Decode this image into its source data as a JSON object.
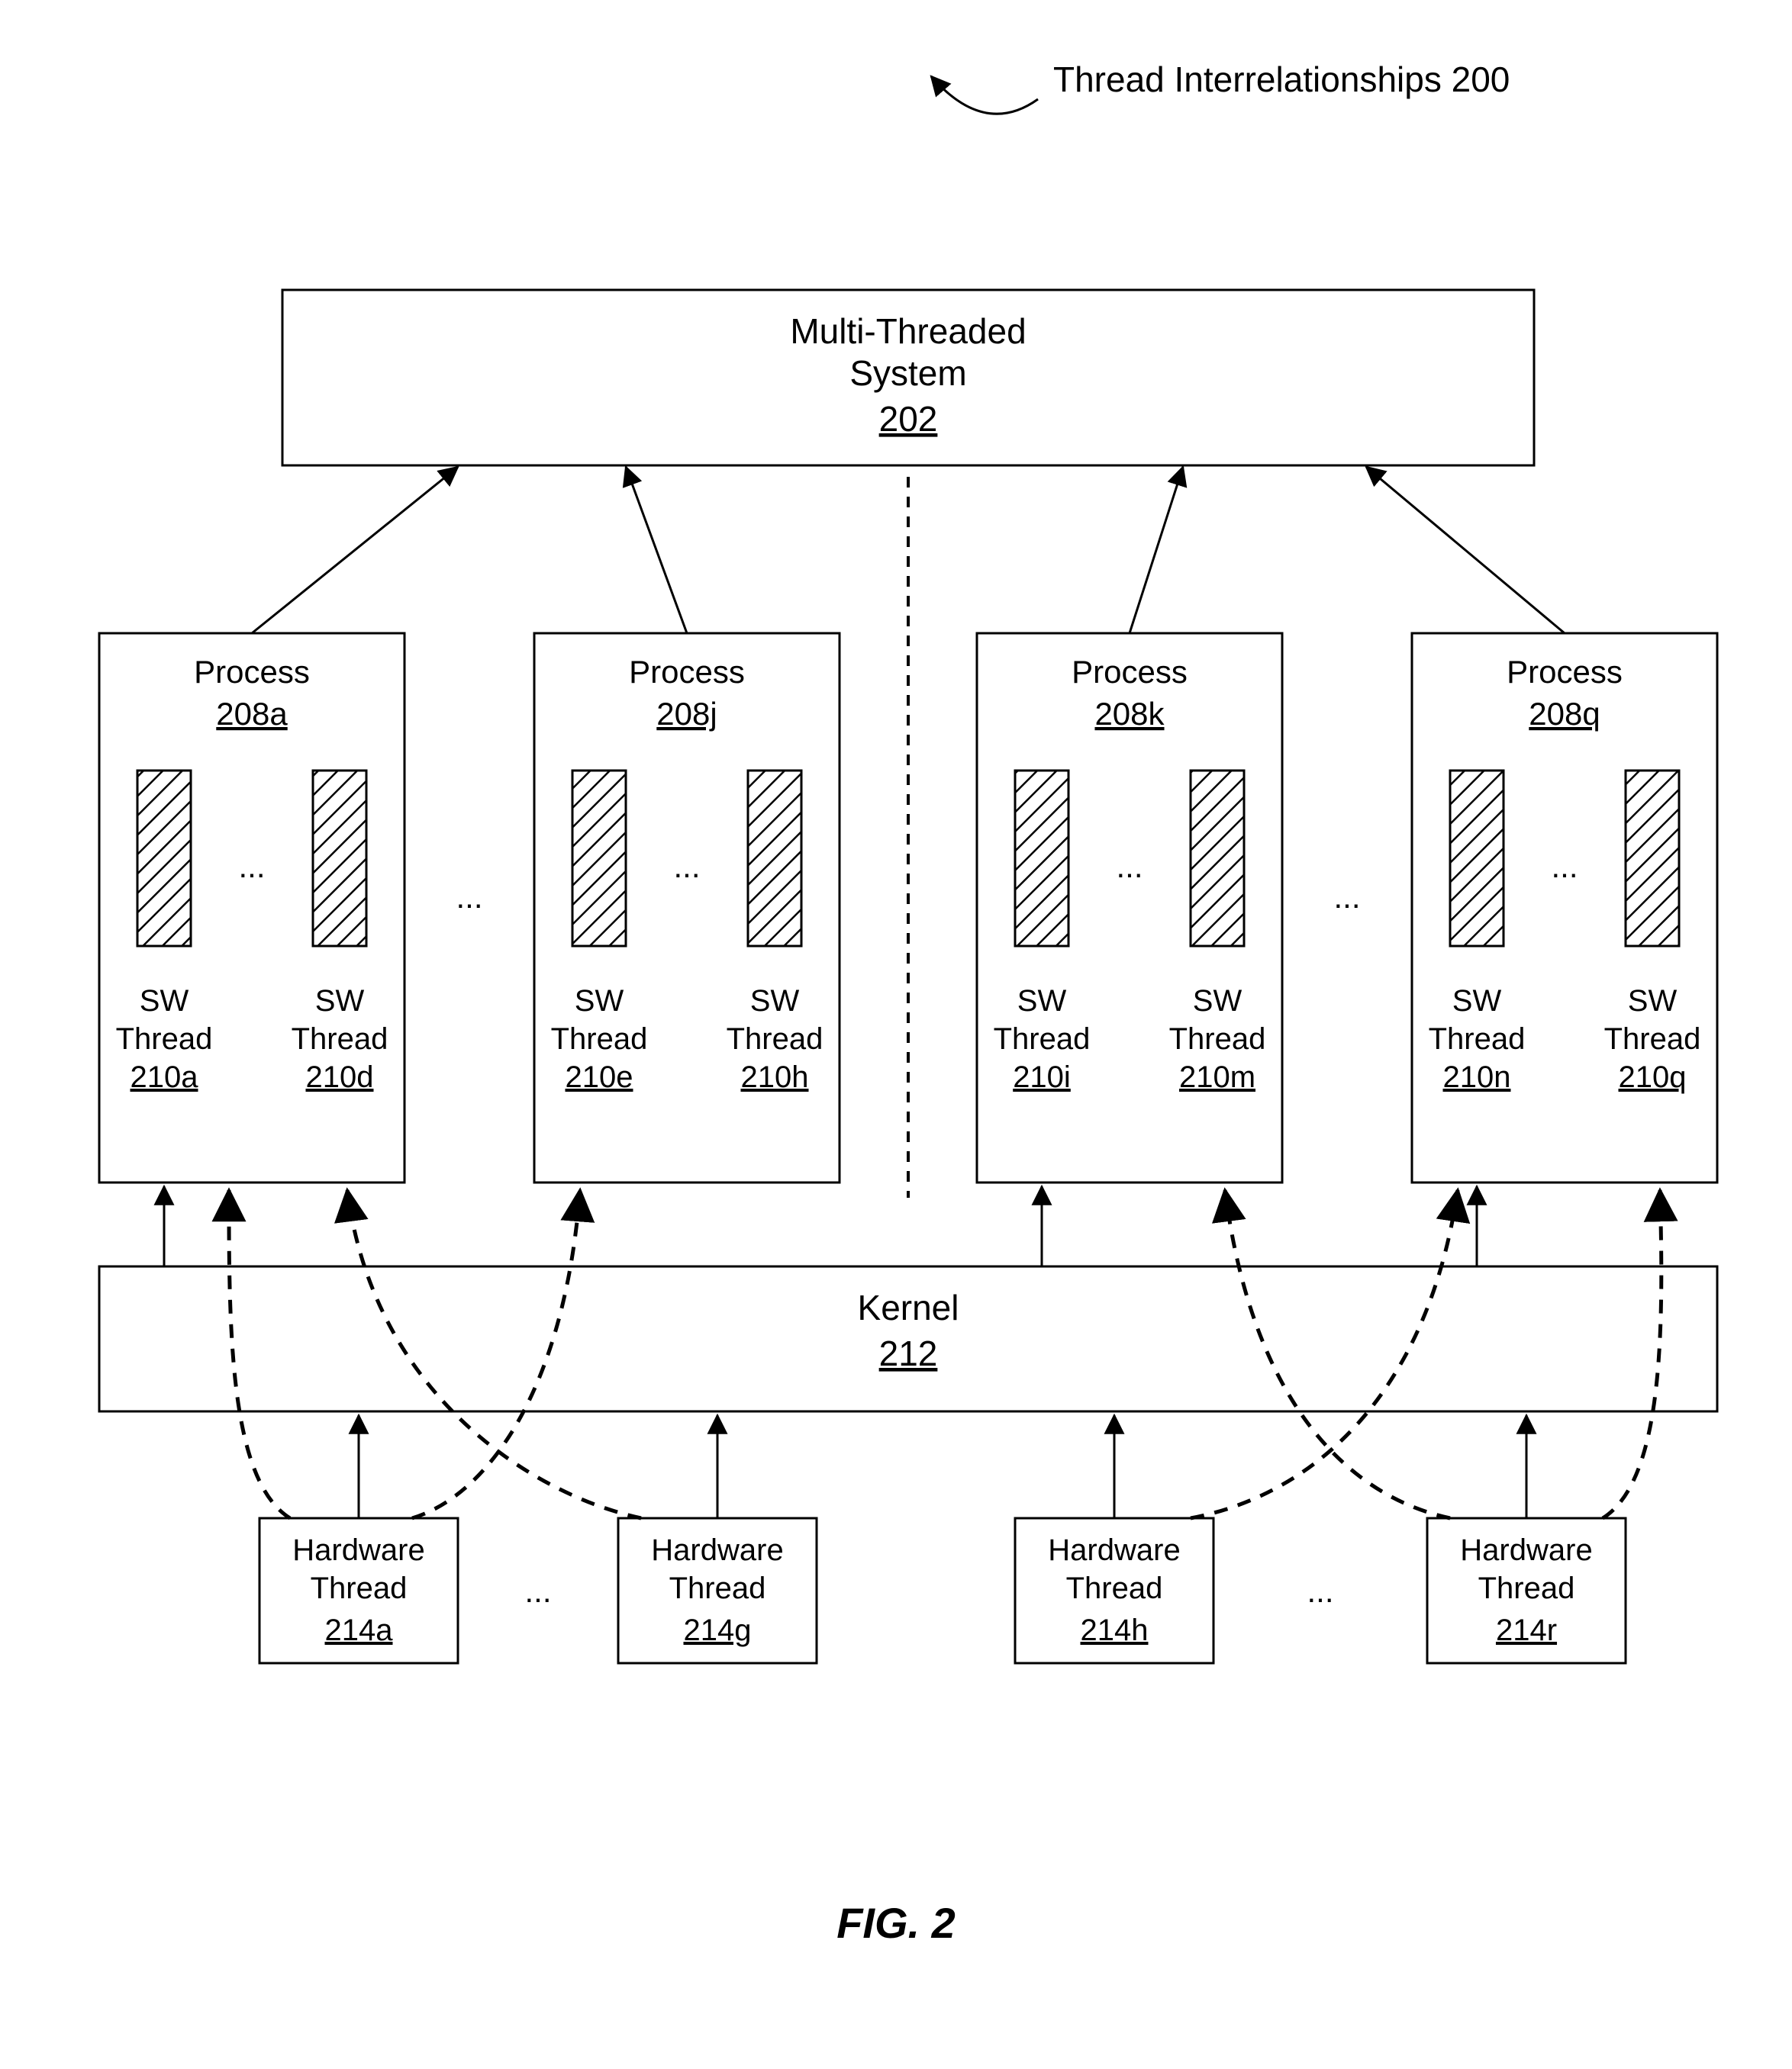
{
  "header": {
    "title": "Thread Interrelationships 200"
  },
  "mts": {
    "l1": "Multi-Threaded",
    "l2": "System",
    "id": "202"
  },
  "process": {
    "a": {
      "label": "Process",
      "id": "208a"
    },
    "j": {
      "label": "Process",
      "id": "208j"
    },
    "k": {
      "label": "Process",
      "id": "208k"
    },
    "q": {
      "label": "Process",
      "id": "208q"
    }
  },
  "sw": {
    "label_l1": "SW",
    "label_l2": "Thread",
    "a": "210a",
    "d": "210d",
    "e": "210e",
    "h": "210h",
    "i": "210i",
    "m": "210m",
    "n": "210n",
    "q": "210q"
  },
  "kernel": {
    "label": "Kernel",
    "id": "212"
  },
  "hw": {
    "l1": "Hardware",
    "l2": "Thread",
    "a": "214a",
    "g": "214g",
    "h": "214h",
    "r": "214r"
  },
  "figure": "FIG. 2",
  "ellipsis": "..."
}
